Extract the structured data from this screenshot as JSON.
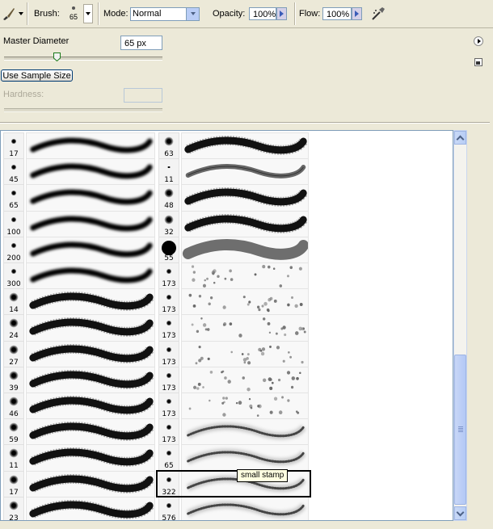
{
  "options": {
    "brush_label": "Brush:",
    "brush_size": "65",
    "mode_label": "Mode:",
    "mode_value": "Normal",
    "opacity_label": "Opacity:",
    "opacity_value": "100%",
    "flow_label": "Flow:",
    "flow_value": "100%"
  },
  "panel": {
    "master_diameter_label": "Master Diameter",
    "master_diameter_value": "65 px",
    "master_diameter_slider": 0.33,
    "use_sample_size_label": "Use Sample Size",
    "hardness_label": "Hardness:",
    "hardness_value": ""
  },
  "brushes_col1": [
    {
      "size": "17",
      "kind": "soft"
    },
    {
      "size": "45",
      "kind": "soft"
    },
    {
      "size": "65",
      "kind": "soft"
    },
    {
      "size": "100",
      "kind": "soft"
    },
    {
      "size": "200",
      "kind": "soft"
    },
    {
      "size": "300",
      "kind": "soft"
    },
    {
      "size": "14",
      "kind": "rough"
    },
    {
      "size": "24",
      "kind": "rough"
    },
    {
      "size": "27",
      "kind": "rough"
    },
    {
      "size": "39",
      "kind": "rough"
    },
    {
      "size": "46",
      "kind": "rough"
    },
    {
      "size": "59",
      "kind": "rough"
    },
    {
      "size": "11",
      "kind": "rough"
    },
    {
      "size": "17",
      "kind": "rough"
    },
    {
      "size": "23",
      "kind": "rough"
    }
  ],
  "brushes_col2": [
    {
      "size": "63",
      "kind": "rough"
    },
    {
      "size": "11",
      "kind": "thin"
    },
    {
      "size": "48",
      "kind": "rough"
    },
    {
      "size": "32",
      "kind": "rough"
    },
    {
      "size": "55",
      "kind": "hard"
    },
    {
      "size": "173",
      "kind": "scatter"
    },
    {
      "size": "173",
      "kind": "scatter"
    },
    {
      "size": "173",
      "kind": "scatter"
    },
    {
      "size": "173",
      "kind": "scatter"
    },
    {
      "size": "173",
      "kind": "scatter"
    },
    {
      "size": "173",
      "kind": "scatter"
    },
    {
      "size": "173",
      "kind": "stamp"
    },
    {
      "size": "65",
      "kind": "stamp"
    },
    {
      "size": "322",
      "kind": "stamp"
    },
    {
      "size": "576",
      "kind": "stamp"
    }
  ],
  "selected": {
    "column": 2,
    "row": 13
  },
  "tooltip": "small stamp"
}
